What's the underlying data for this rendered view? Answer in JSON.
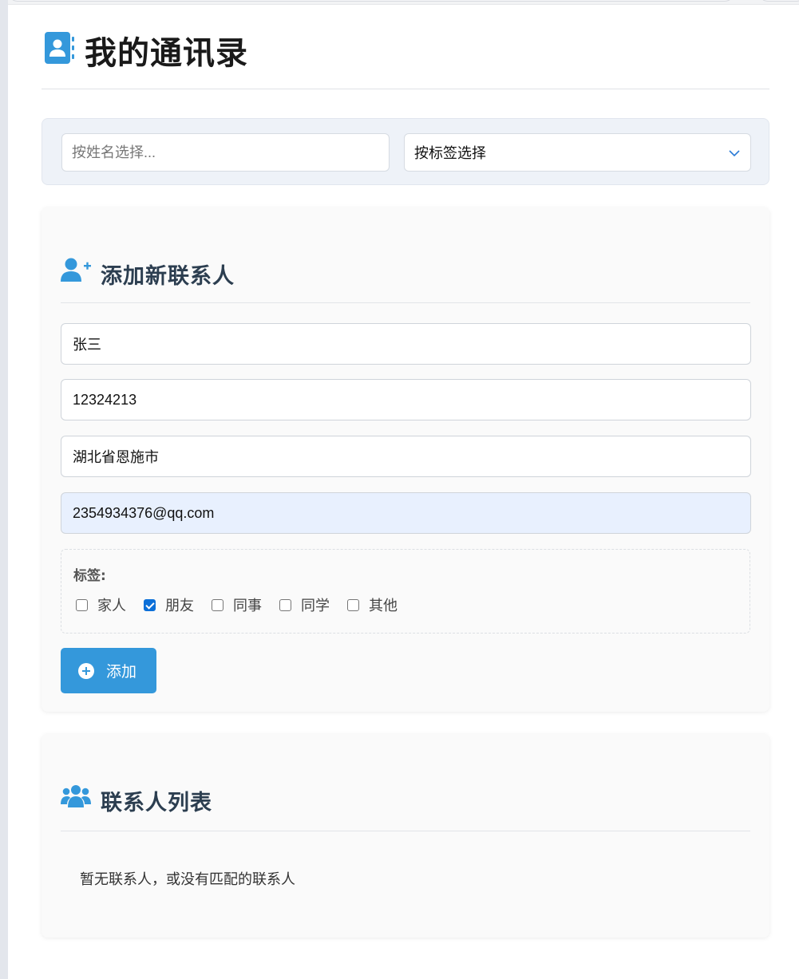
{
  "header": {
    "title": "我的通讯录",
    "icon": "address-book-icon"
  },
  "filters": {
    "name_placeholder": "按姓名选择...",
    "tag_selected": "按标签选择"
  },
  "add_section": {
    "title": "添加新联系人",
    "icon": "user-plus-icon",
    "fields": {
      "name": "张三",
      "phone": "12324213",
      "address": "湖北省恩施市",
      "email": "2354934376@qq.com"
    },
    "tags_label": "标签:",
    "tags": [
      {
        "label": "家人",
        "checked": false
      },
      {
        "label": "朋友",
        "checked": true
      },
      {
        "label": "同事",
        "checked": false
      },
      {
        "label": "同学",
        "checked": false
      },
      {
        "label": "其他",
        "checked": false
      }
    ],
    "add_button": "添加"
  },
  "list_section": {
    "title": "联系人列表",
    "icon": "users-icon",
    "empty_message": "暂无联系人，或没有匹配的联系人"
  },
  "colors": {
    "accent": "#3498db",
    "title": "#2c3e50",
    "filter_bg": "#eef2f8"
  }
}
